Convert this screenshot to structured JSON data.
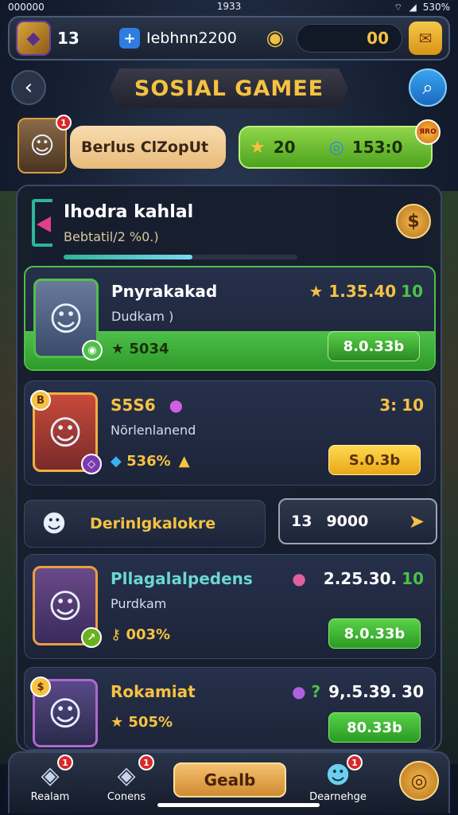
{
  "status_bar": {
    "left": "000000",
    "time": "1933",
    "battery": "530%"
  },
  "topbar": {
    "level": "13",
    "player_id": "Iebhnn2200",
    "gold": "00"
  },
  "header": {
    "title": "SOSIAL GAMEE"
  },
  "profile": {
    "name": "Berlus ClZopUt",
    "badge": "1",
    "star_count": "20",
    "gem_count": "153:0",
    "hot_label": "ЯRO"
  },
  "panel": {
    "title": "Ihodra kahlal",
    "subtitle": "Bebtatil/2 %0.)",
    "progress": 0.55
  },
  "cards": [
    {
      "name": "Pnyrakakad",
      "sub": "Dudkam )",
      "stat": "5034",
      "score": "1.35.40",
      "score_tail": "10",
      "action": "8.0.33b"
    },
    {
      "name": "S5S6",
      "sub": "Nörlenlanend",
      "stat": "536%",
      "score": "3:",
      "score_tail": "10",
      "action": "S.0.3b"
    },
    {
      "name": "Pllagalalpedens",
      "sub": "Purdkam",
      "stat": "003%",
      "score": "2.25.30.",
      "score_tail": "10",
      "action": "8.0.33b"
    },
    {
      "name": "Rokamiat",
      "sub": "",
      "stat": "505%",
      "score": "9,.5.39.",
      "score_tail": "30",
      "action": "80.33b"
    }
  ],
  "mid_row": {
    "label": "Derinlgkalokre",
    "value_a": "13",
    "value_b": "9000"
  },
  "bottom_nav": {
    "items": [
      "Realam",
      "Conens",
      "Dearnehge"
    ],
    "center_label": "Gealb",
    "badges": [
      "1",
      "1",
      "1"
    ]
  },
  "colors": {
    "accent": "#f5c242",
    "positive": "#4ec04a",
    "brand": "#2f7de0"
  }
}
